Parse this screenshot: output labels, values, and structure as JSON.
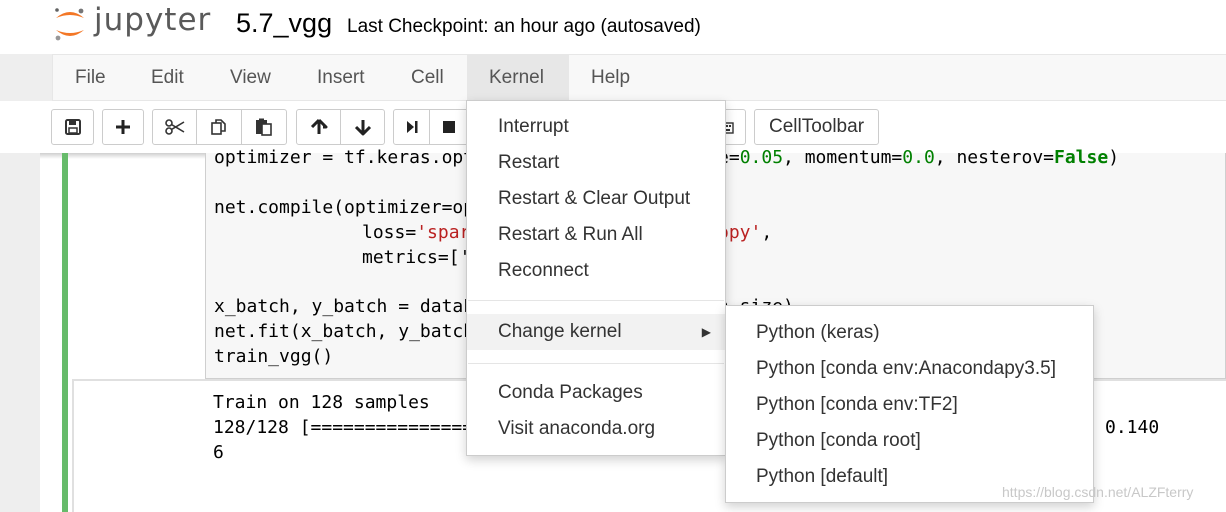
{
  "header": {
    "logo_text": "jupyter",
    "notebook_name": "5.7_vgg",
    "checkpoint": "Last Checkpoint: an hour ago (autosaved)"
  },
  "menubar": {
    "items": [
      "File",
      "Edit",
      "View",
      "Insert",
      "Cell",
      "Kernel",
      "Help"
    ],
    "active": "Kernel"
  },
  "toolbar": {
    "celltoolbar_label": "CellToolbar",
    "icons": [
      "save-icon",
      "plus-icon",
      "cut-icon",
      "copy-icon",
      "paste-icon",
      "arrow-up-icon",
      "arrow-down-icon",
      "run-icon",
      "stop-icon",
      "keyboard-icon"
    ]
  },
  "code": {
    "lines": [
      "optimizer = tf.keras.opt",
      "e=0.05, momentum=0.0, nesterov=False)",
      "net.compile(optimizer=op",
      "loss='spar",
      "opy',",
      "metrics=['",
      "x_batch, y_batch = dataL",
      "h_size)",
      "net.fit(x_batch, y_batch",
      "train_vgg()"
    ]
  },
  "output": {
    "lines": [
      "Train on 128 samples",
      "128/128 [===============",
      "6",
      "0.140"
    ]
  },
  "kernel_menu": {
    "items": [
      "Interrupt",
      "Restart",
      "Restart & Clear Output",
      "Restart & Run All",
      "Reconnect"
    ],
    "change_kernel": "Change kernel",
    "extra_items": [
      "Conda Packages",
      "Visit anaconda.org"
    ]
  },
  "change_kernel_submenu": {
    "items": [
      "Python (keras)",
      "Python [conda env:Anacondapy3.5]",
      "Python [conda env:TF2]",
      "Python [conda root]",
      "Python [default]"
    ]
  },
  "watermark": "https://blog.csdn.net/ALZFterry",
  "colors": {
    "cell_bar": "#66bb6a",
    "keyword": "#008000",
    "string": "#ba2121",
    "logo_orange": "#f37726"
  }
}
